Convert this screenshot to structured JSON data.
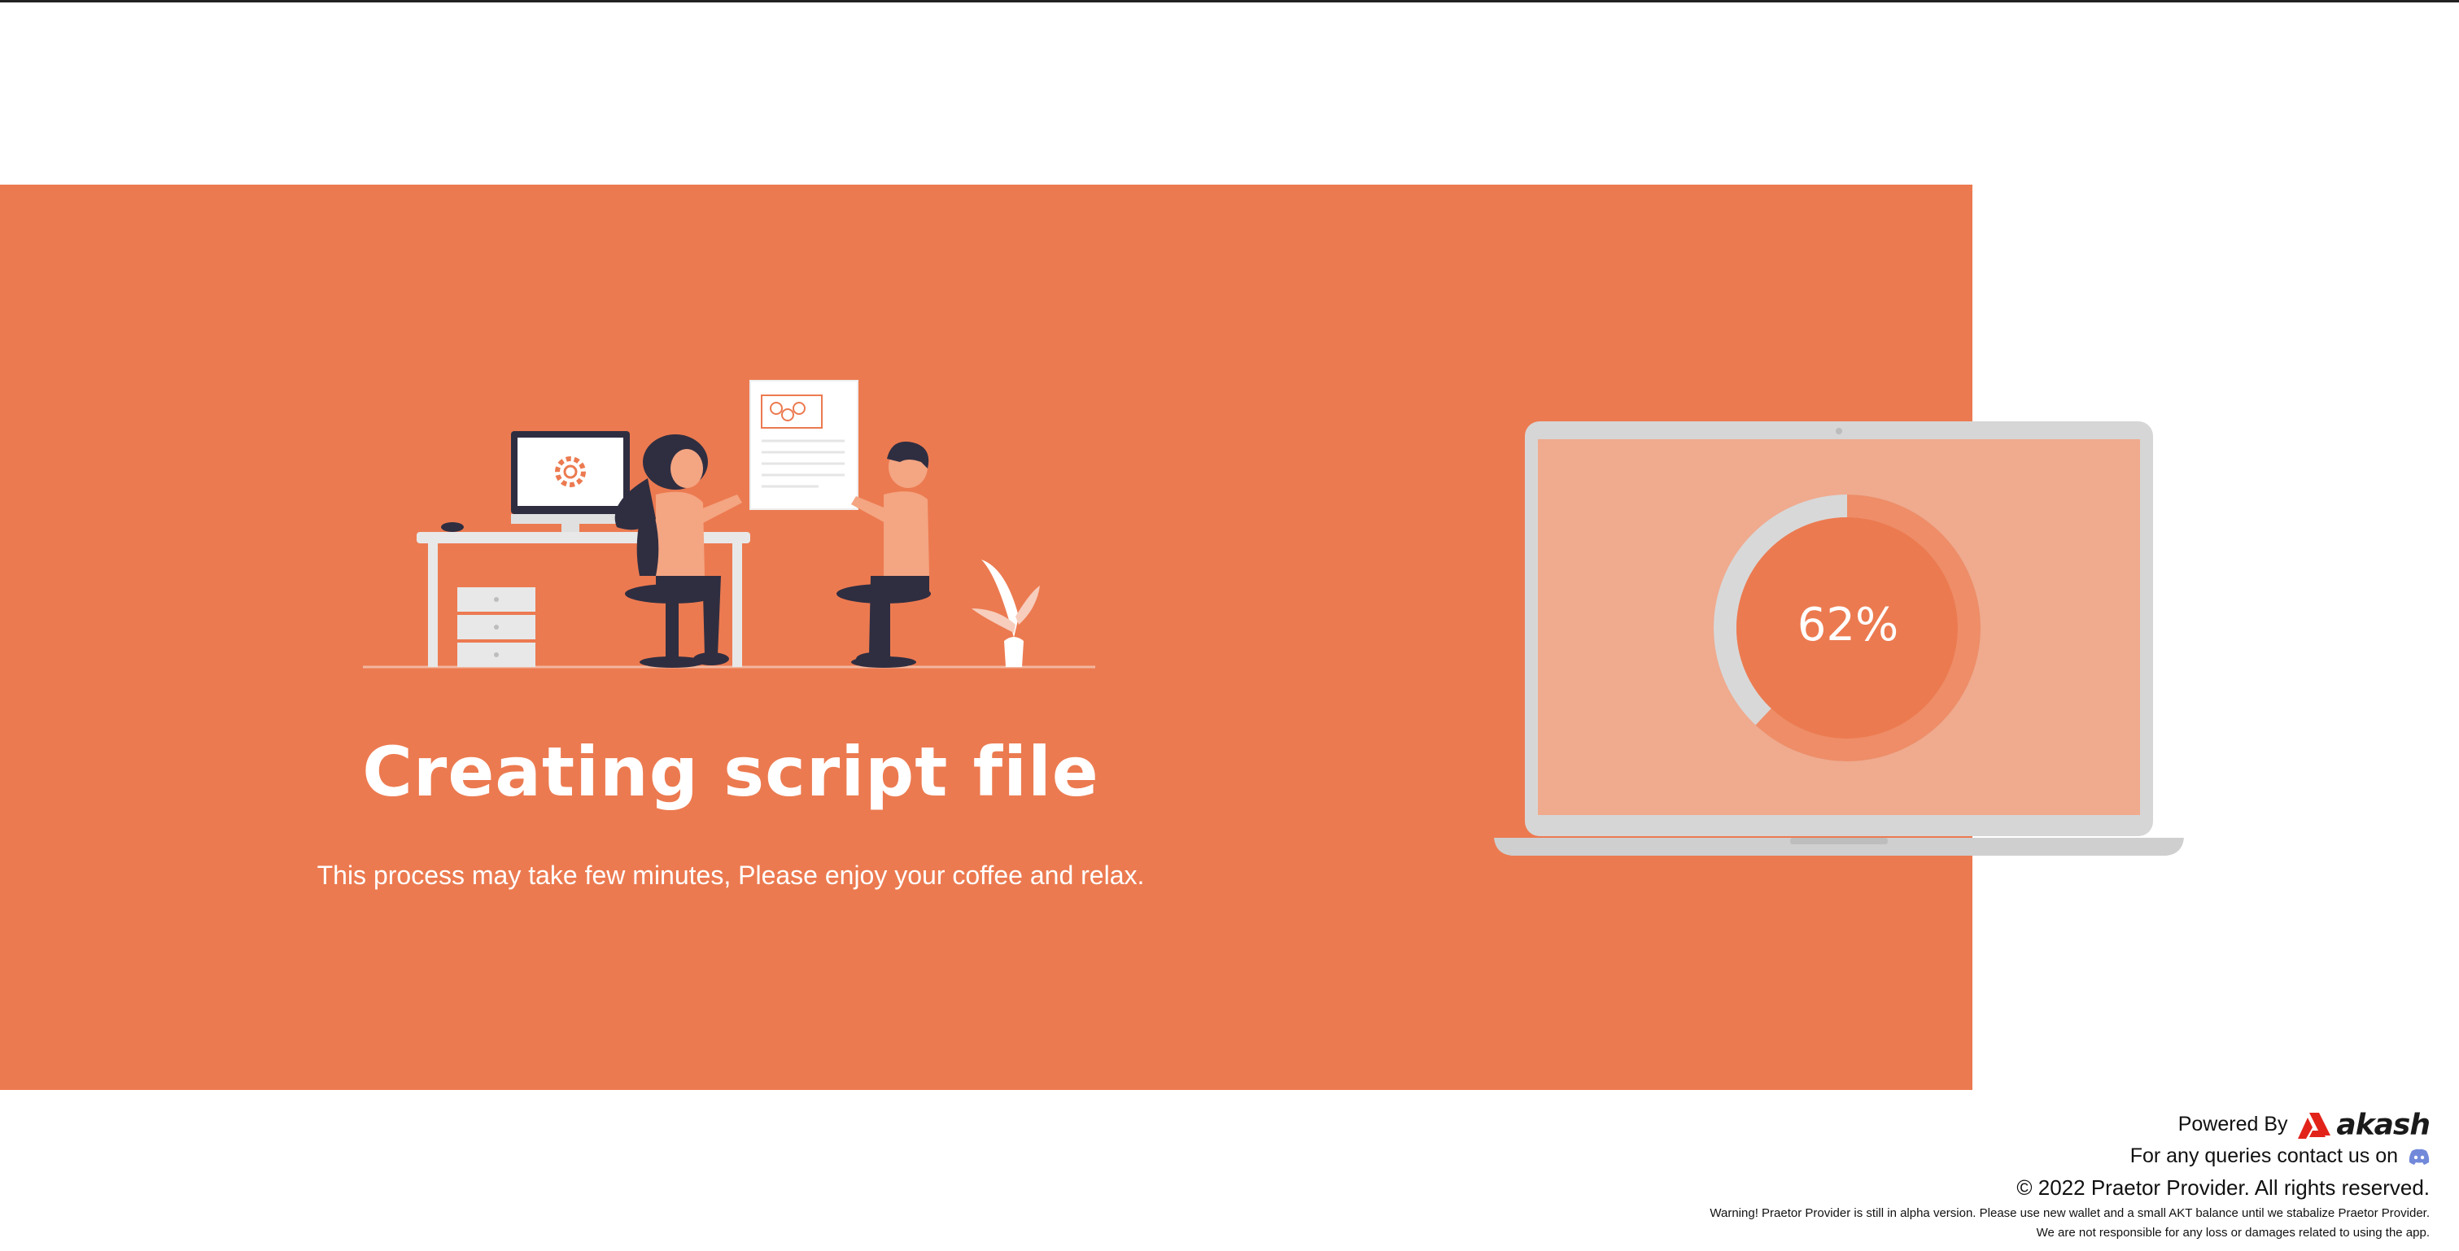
{
  "loading": {
    "title": "Creating script file",
    "subtitle": "This process may take few minutes, Please enjoy your coffee and relax.",
    "progress_percent": 62,
    "progress_label": "62%"
  },
  "footer": {
    "powered_by": "Powered By",
    "brand_name": "akash",
    "contact_text": "For any queries contact us on",
    "contact_icon": "discord-icon",
    "copyright": "© 2022 Praetor Provider. All rights reserved.",
    "warning_line1": "Warning! Praetor Provider is still in alpha version. Please use new wallet and a small AKT balance until we stabalize Praetor Provider.",
    "warning_line2": "We are not responsible for any loss or damages related to using the app."
  },
  "colors": {
    "accent": "#ec7a50",
    "screen": "#f0aa8e",
    "laptop_frame": "#d6d6d6",
    "discord": "#7289da",
    "akash_red": "#e2231a"
  }
}
